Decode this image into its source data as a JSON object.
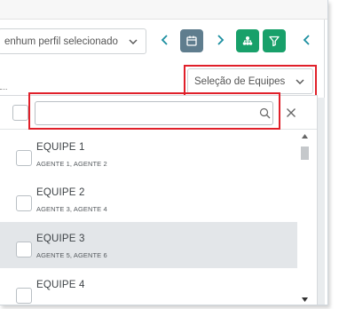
{
  "toolbar": {
    "profile_select_value": "enhum perfil selecionado",
    "prev_label": "‹",
    "next_label": "›",
    "collapse_label": "‹"
  },
  "team_filter": {
    "select_value": "Seleção de Equipes"
  },
  "dropdown": {
    "search_placeholder": "",
    "search_value": "",
    "items": [
      {
        "name": "EQUIPE 1",
        "agents": "AGENTE 1, AGENTE 2",
        "selected": false
      },
      {
        "name": "EQUIPE 2",
        "agents": "AGENTE 3, AGENTE 4",
        "selected": false
      },
      {
        "name": "EQUIPE 3",
        "agents": "AGENTE 5, AGENTE 6",
        "selected": true
      },
      {
        "name": "EQUIPE 4",
        "agents": "",
        "selected": false
      }
    ]
  },
  "colors": {
    "accent_green": "#18a06a",
    "calendar_button": "#5f7d8e",
    "chevron_teal": "#1b8fa0",
    "highlight_red": "#e0202a",
    "selected_row": "#e3e6e9"
  },
  "icons": [
    "chevron-down-icon",
    "calendar-icon",
    "sitemap-icon",
    "filter-icon",
    "search-icon",
    "close-icon"
  ]
}
